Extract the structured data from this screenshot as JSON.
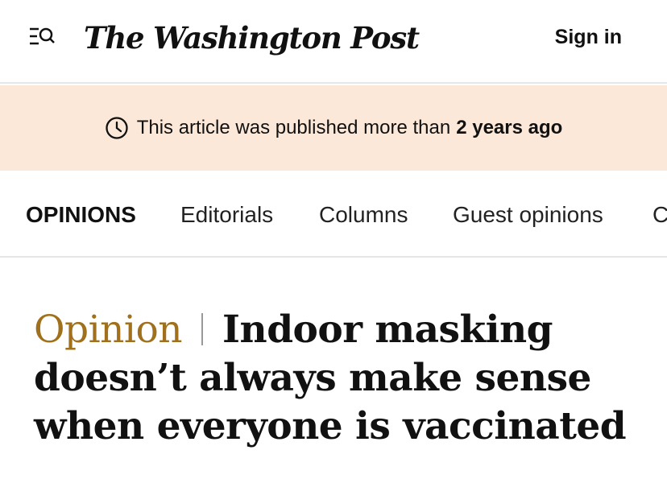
{
  "header": {
    "logo_text": "The Washington Post",
    "sign_in_label": "Sign in",
    "menu_icon": "menu-search-icon"
  },
  "notice": {
    "icon": "clock-icon",
    "text": "This article was published more than",
    "emphasis": "2 years ago",
    "background": "#fce8d8"
  },
  "subnav": {
    "section": "OPINIONS",
    "items": [
      "Editorials",
      "Columns",
      "Guest opinions",
      "C"
    ]
  },
  "article": {
    "kicker": "Opinion",
    "kicker_color": "#a0701c",
    "title": "Indoor masking doesn’t always make sense when everyone is vaccinated"
  }
}
